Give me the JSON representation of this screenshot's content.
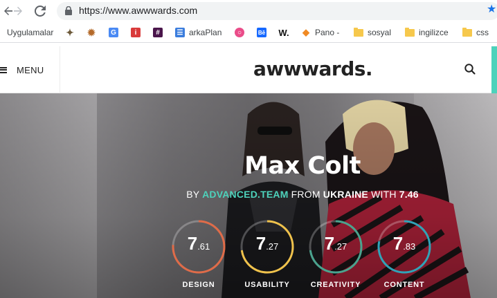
{
  "browser": {
    "url": "https://www.awwwards.com",
    "bookmarks": [
      {
        "label": "Uygulamalar",
        "icon": "apps-grid-icon"
      },
      {
        "label": "",
        "icon": "bird-icon"
      },
      {
        "label": "",
        "icon": "sprite-icon"
      },
      {
        "label": "",
        "icon": "google-translate-icon"
      },
      {
        "label": "",
        "icon": "red-app-icon"
      },
      {
        "label": "",
        "icon": "slack-icon"
      },
      {
        "label": "arkaPlan",
        "icon": "layers-icon"
      },
      {
        "label": "",
        "icon": "dribbble-icon"
      },
      {
        "label": "",
        "icon": "behance-icon"
      },
      {
        "label": "",
        "icon": "w-icon"
      },
      {
        "label": "Pano -",
        "icon": "pano-icon"
      },
      {
        "label": "sosyal",
        "icon": "folder-icon"
      },
      {
        "label": "ingilizce",
        "icon": "folder-icon"
      },
      {
        "label": "css",
        "icon": "folder-icon"
      }
    ]
  },
  "header": {
    "menu_label": "MENU",
    "logo": "awwwards."
  },
  "hero": {
    "title": "Max Colt",
    "byline": {
      "by": "BY",
      "agency": "ADVANCED.TEAM",
      "from": "FROM",
      "country": "UKRAINE",
      "with": "WITH",
      "score": "7.46"
    },
    "scores": [
      {
        "label": "DESIGN",
        "int": "7",
        "dec": ".61",
        "value": 7.61,
        "color": "#e06b48"
      },
      {
        "label": "USABILITY",
        "int": "7",
        "dec": ".27",
        "value": 7.27,
        "color": "#f0c24b"
      },
      {
        "label": "CREATIVITY",
        "int": "7",
        "dec": ".27",
        "value": 7.27,
        "color": "#4aa38e"
      },
      {
        "label": "CONTENT",
        "int": "7",
        "dec": ".83",
        "value": 7.83,
        "color": "#2fa3b8"
      }
    ]
  }
}
